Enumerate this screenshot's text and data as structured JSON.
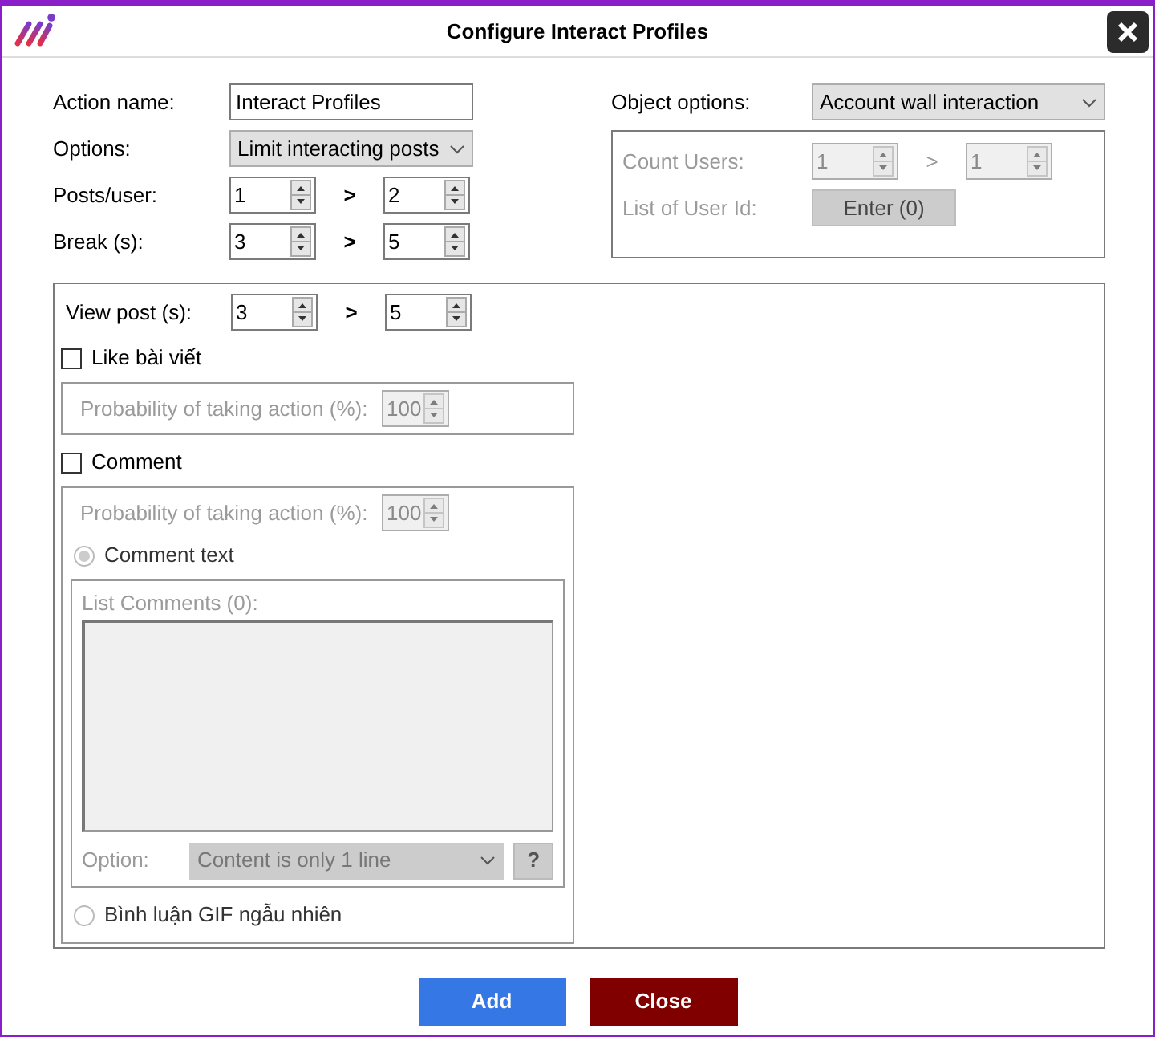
{
  "window": {
    "title": "Configure Interact Profiles"
  },
  "action_name": {
    "label": "Action name:",
    "value": "Interact Profiles"
  },
  "options": {
    "label": "Options:",
    "value": "Limit interacting posts"
  },
  "posts_per_user": {
    "label": "Posts/user:",
    "from": "1",
    "separator": ">",
    "to": "2"
  },
  "break": {
    "label": "Break (s):",
    "from": "3",
    "separator": ">",
    "to": "5"
  },
  "object_options": {
    "label": "Object options:",
    "value": "Account wall interaction"
  },
  "object_box": {
    "disabled": true,
    "count_users": {
      "label": "Count Users:",
      "from": "1",
      "separator": ">",
      "to": "1"
    },
    "user_id_list": {
      "label": "List of User Id:",
      "button": "Enter (0)"
    }
  },
  "view_post": {
    "label": "View post (s):",
    "from": "3",
    "separator": ">",
    "to": "5"
  },
  "like": {
    "label": "Like bài viết",
    "checked": false,
    "probability": {
      "label": "Probability of taking action (%):",
      "value": "100",
      "disabled": true
    }
  },
  "comment": {
    "label": "Comment",
    "checked": false,
    "probability": {
      "label": "Probability of taking action (%):",
      "value": "100",
      "disabled": true
    },
    "radios": [
      {
        "label": "Comment text",
        "selected": true,
        "disabled": true
      },
      {
        "label": "Bình luận GIF ngẫu nhiên",
        "selected": false,
        "disabled": true
      }
    ],
    "list": {
      "label": "List Comments (0):",
      "disabled": true
    },
    "option": {
      "label": "Option:",
      "value": "Content is only 1 line",
      "help": "?",
      "disabled": true
    }
  },
  "buttons": [
    {
      "label": "Add",
      "kind": "primary"
    },
    {
      "label": "Close",
      "kind": "danger"
    }
  ]
}
